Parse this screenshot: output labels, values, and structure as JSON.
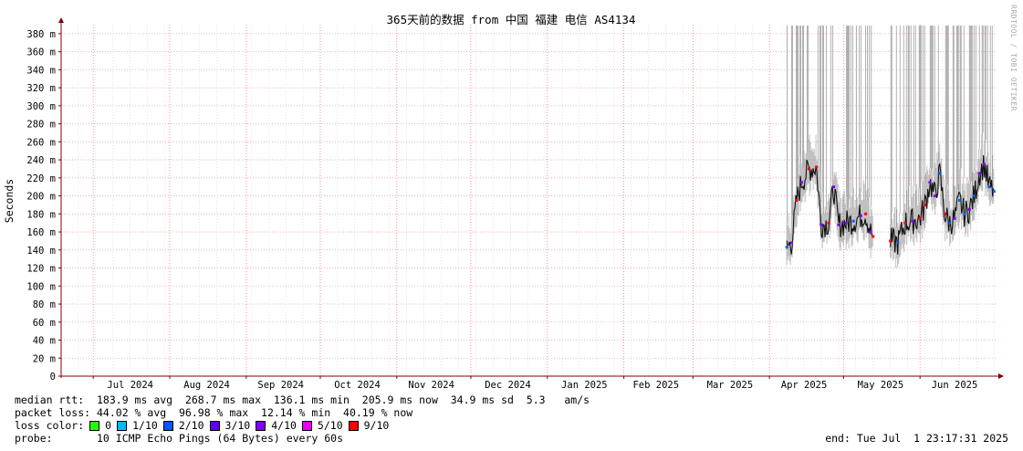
{
  "chart_data": {
    "type": "line",
    "title": "365天前的数据 from 中国 福建 电信 AS4134",
    "ylabel": "Seconds",
    "ylim": [
      0,
      0.39
    ],
    "yticks": [
      {
        "v": 0,
        "label": "0"
      },
      {
        "v": 0.02,
        "label": "20 m"
      },
      {
        "v": 0.04,
        "label": "40 m"
      },
      {
        "v": 0.06,
        "label": "60 m"
      },
      {
        "v": 0.08,
        "label": "80 m"
      },
      {
        "v": 0.1,
        "label": "100 m"
      },
      {
        "v": 0.12,
        "label": "120 m"
      },
      {
        "v": 0.14,
        "label": "140 m"
      },
      {
        "v": 0.16,
        "label": "160 m"
      },
      {
        "v": 0.18,
        "label": "180 m"
      },
      {
        "v": 0.2,
        "label": "200 m"
      },
      {
        "v": 0.22,
        "label": "220 m"
      },
      {
        "v": 0.24,
        "label": "240 m"
      },
      {
        "v": 0.26,
        "label": "260 m"
      },
      {
        "v": 0.28,
        "label": "280 m"
      },
      {
        "v": 0.3,
        "label": "300 m"
      },
      {
        "v": 0.32,
        "label": "320 m"
      },
      {
        "v": 0.34,
        "label": "340 m"
      },
      {
        "v": 0.36,
        "label": "360 m"
      },
      {
        "v": 0.38,
        "label": "380 m"
      }
    ],
    "xlim": [
      "2024-06-18",
      "2025-07-02"
    ],
    "month_boundaries": [
      "2024-07-01",
      "2024-08-01",
      "2024-09-01",
      "2024-10-01",
      "2024-11-01",
      "2024-12-01",
      "2025-01-01",
      "2025-02-01",
      "2025-03-01",
      "2025-04-01",
      "2025-05-01",
      "2025-06-01"
    ],
    "xticks": [
      {
        "date": "2024-07-16",
        "label": "Jul 2024"
      },
      {
        "date": "2024-08-16",
        "label": "Aug 2024"
      },
      {
        "date": "2024-09-15",
        "label": "Sep 2024"
      },
      {
        "date": "2024-10-16",
        "label": "Oct 2024"
      },
      {
        "date": "2024-11-15",
        "label": "Nov 2024"
      },
      {
        "date": "2024-12-16",
        "label": "Dec 2024"
      },
      {
        "date": "2025-01-16",
        "label": "Jan 2025"
      },
      {
        "date": "2025-02-14",
        "label": "Feb 2025"
      },
      {
        "date": "2025-03-16",
        "label": "Mar 2025"
      },
      {
        "date": "2025-04-15",
        "label": "Apr 2025"
      },
      {
        "date": "2025-05-16",
        "label": "May 2025"
      },
      {
        "date": "2025-06-15",
        "label": "Jun 2025"
      }
    ],
    "grid": true,
    "series": [
      {
        "segments": [
          {
            "start": "2025-04-08",
            "end": "2025-05-13",
            "points": [
              [
                "2025-04-08",
                0.143
              ],
              [
                "2025-04-10",
                0.148
              ],
              [
                "2025-04-12",
                0.195
              ],
              [
                "2025-04-14",
                0.215
              ],
              [
                "2025-04-17",
                0.23
              ],
              [
                "2025-04-20",
                0.232
              ],
              [
                "2025-04-22",
                0.168
              ],
              [
                "2025-04-25",
                0.17
              ],
              [
                "2025-04-27",
                0.21
              ],
              [
                "2025-04-29",
                0.168
              ],
              [
                "2025-05-02",
                0.17
              ],
              [
                "2025-05-05",
                0.172
              ],
              [
                "2025-05-08",
                0.178
              ],
              [
                "2025-05-10",
                0.18
              ],
              [
                "2025-05-12",
                0.16
              ],
              [
                "2025-05-13",
                0.155
              ]
            ]
          },
          {
            "start": "2025-05-20",
            "end": "2025-07-01",
            "points": [
              [
                "2025-05-20",
                0.15
              ],
              [
                "2025-05-23",
                0.148
              ],
              [
                "2025-05-26",
                0.17
              ],
              [
                "2025-05-29",
                0.172
              ],
              [
                "2025-06-01",
                0.175
              ],
              [
                "2025-06-03",
                0.19
              ],
              [
                "2025-06-05",
                0.215
              ],
              [
                "2025-06-07",
                0.2
              ],
              [
                "2025-06-09",
                0.225
              ],
              [
                "2025-06-11",
                0.18
              ],
              [
                "2025-06-13",
                0.17
              ],
              [
                "2025-06-15",
                0.175
              ],
              [
                "2025-06-17",
                0.195
              ],
              [
                "2025-06-19",
                0.18
              ],
              [
                "2025-06-21",
                0.185
              ],
              [
                "2025-06-23",
                0.2
              ],
              [
                "2025-06-25",
                0.225
              ],
              [
                "2025-06-27",
                0.235
              ],
              [
                "2025-06-29",
                0.21
              ],
              [
                "2025-07-01",
                0.205
              ]
            ]
          }
        ]
      }
    ]
  },
  "stats": {
    "median_rtt": "median rtt:  183.9 ms avg  268.7 ms max  136.1 ms min  205.9 ms now  34.9 ms sd  5.3   am/s",
    "packet_loss": "packet loss: 44.02 % avg  96.98 % max  12.14 % min  40.19 % now",
    "loss_color_label": "loss color:",
    "probe": "probe:       10 ICMP Echo Pings (64 Bytes) every 60s",
    "end": "end: Tue Jul  1 23:17:31 2025"
  },
  "loss_legend": [
    {
      "label": "0",
      "color": "#26ff00"
    },
    {
      "label": "1/10",
      "color": "#00b8ff"
    },
    {
      "label": "2/10",
      "color": "#0059ff"
    },
    {
      "label": "3/10",
      "color": "#5e00ff"
    },
    {
      "label": "4/10",
      "color": "#7e00ff"
    },
    {
      "label": "5/10",
      "color": "#dd00ff"
    },
    {
      "label": "9/10",
      "color": "#ff0000"
    }
  ],
  "watermark": "RRDTOOL / TOBI OETIKER",
  "colors": {
    "grid": "#e7a3a3",
    "axis": "#800000",
    "smoke": "#888888",
    "median_line": "#111111"
  }
}
